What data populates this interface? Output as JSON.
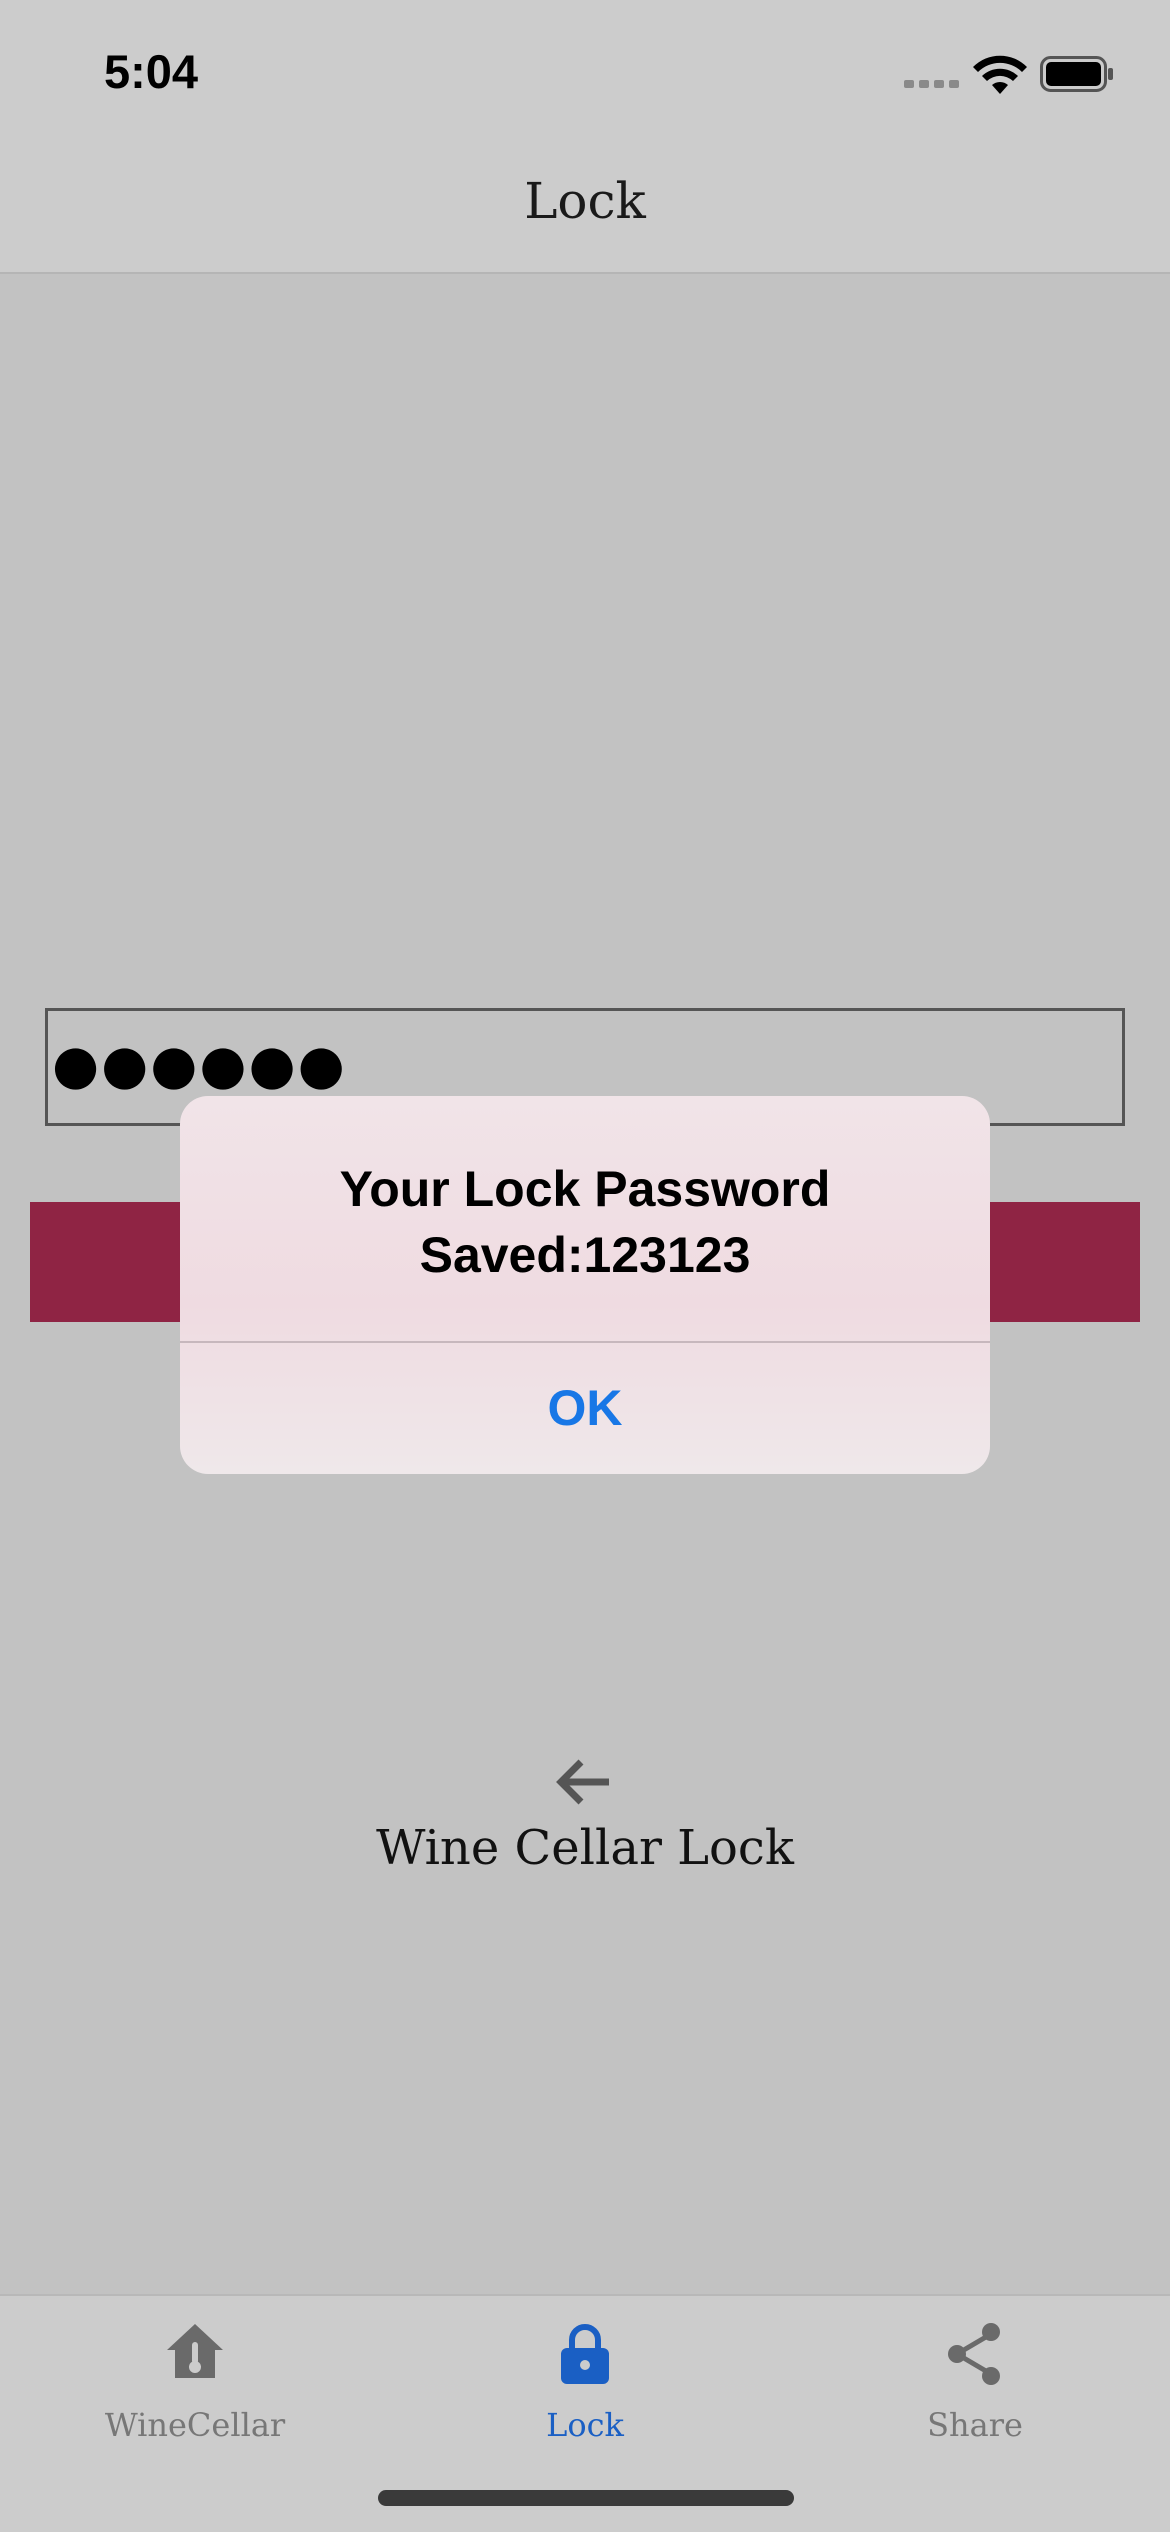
{
  "status_bar": {
    "time": "5:04",
    "icons": [
      "signal-dots-icon",
      "wifi-icon",
      "battery-icon"
    ]
  },
  "nav": {
    "title": "Lock"
  },
  "password_field": {
    "value": "●●●●●●"
  },
  "main": {
    "back_icon": "arrow-left-icon",
    "title": "Wine Cellar Lock"
  },
  "alert": {
    "title": "Your Lock Password\nSaved:123123",
    "ok_label": "OK"
  },
  "tabs": [
    {
      "label": "WineCellar",
      "icon": "home-thermometer-icon",
      "active": false
    },
    {
      "label": "Lock",
      "icon": "lock-icon",
      "active": true
    },
    {
      "label": "Share",
      "icon": "share-icon",
      "active": false
    }
  ],
  "colors": {
    "accent_button": "#8f2444",
    "active_tab": "#1a5fc4",
    "alert_button": "#1877e6",
    "inactive_tab": "#777777"
  }
}
